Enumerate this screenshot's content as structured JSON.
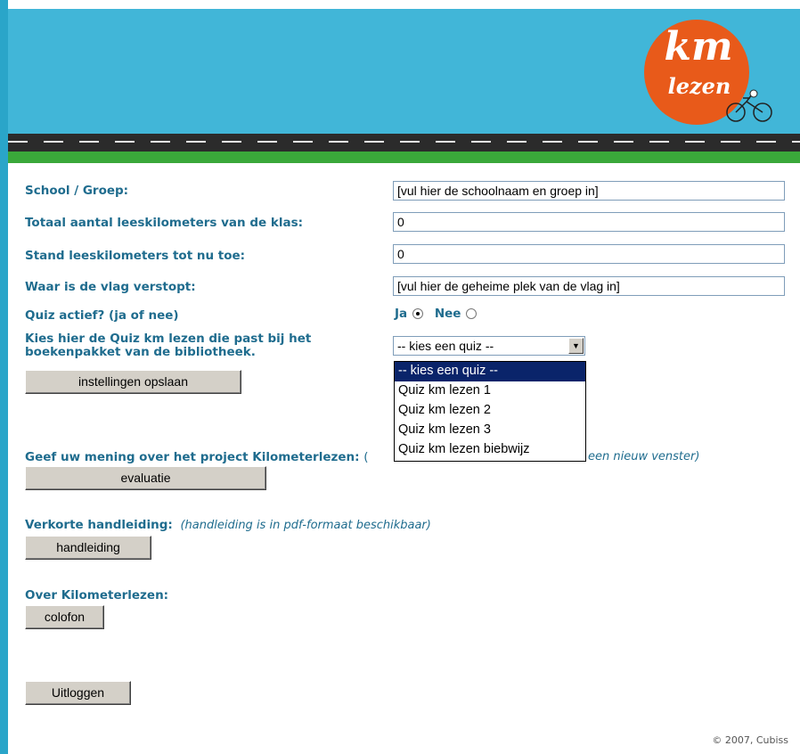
{
  "logo": {
    "km": "km",
    "lezen": "lezen"
  },
  "form": {
    "school_label": "School / Groep:",
    "school_value": "[vul hier de schoolnaam en groep in]",
    "totaal_label": "Totaal aantal leeskilometers van de klas:",
    "totaal_value": "0",
    "stand_label": "Stand leeskilometers tot nu toe:",
    "stand_value": "0",
    "vlag_label": "Waar is de vlag verstopt:",
    "vlag_value": "[vul hier de geheime plek van de vlag in]",
    "quiz_label": "Quiz actief? (ja of nee)",
    "ja": "Ja",
    "nee": "Nee",
    "kies_label_1": "Kies hier de Quiz km lezen die past bij het",
    "kies_label_2": "boekenpakket van de bibliotheek.",
    "select_value": "-- kies een quiz --",
    "options": [
      "-- kies een quiz --",
      "Quiz km lezen 1",
      "Quiz km lezen 2",
      "Quiz km lezen 3",
      "Quiz km lezen biebwijz"
    ],
    "save_button": "instellingen opslaan"
  },
  "evaluatie": {
    "label": "Geef uw mening over het project Kilometerlezen:",
    "note_open": "(",
    "note_tail": "een nieuw venster)",
    "button": "evaluatie"
  },
  "handleiding": {
    "label": "Verkorte handleiding:",
    "note": "(handleiding is in pdf-formaat beschikbaar)",
    "button": "handleiding"
  },
  "colofon": {
    "label": "Over Kilometerlezen:",
    "button": "colofon"
  },
  "logout_button": "Uitloggen",
  "footer": "© 2007, Cubiss",
  "colors": {
    "header": "#41b6d8",
    "label": "#1f6c8e",
    "logo": "#e85a1a"
  }
}
